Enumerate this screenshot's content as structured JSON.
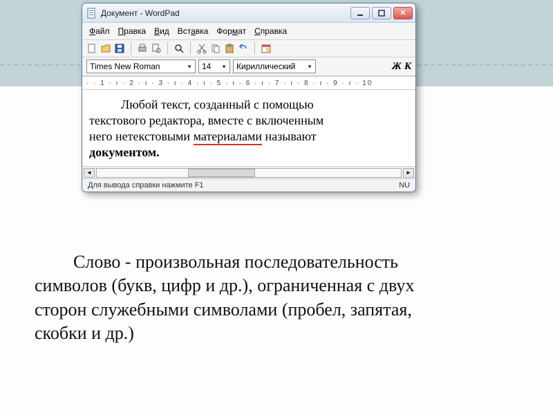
{
  "window": {
    "title": "Документ - WordPad",
    "menus": [
      "Файл",
      "Правка",
      "Вид",
      "Вставка",
      "Формат",
      "Справка"
    ],
    "font_name": "Times New Roman",
    "font_size": "14",
    "charset": "Кириллический",
    "bold_label": "Ж",
    "italic_label": "К",
    "ruler_text": "· · 1 · ı · 2 · ı · 3 · ı · 4 · ı · 5 · ı · 6 · ı · 7 · ı · 8 · ı · 9 · ı · 10",
    "doc": {
      "line1a": "Любой текст, созданный с помощью",
      "line2": "текстового редактора, вместе с включенным",
      "line3a": "него нетекстовыми ",
      "line3u": "материалами",
      "line3b": " называют",
      "line4": "документом."
    },
    "status_left": "Для вывода справки нажмите F1",
    "status_right": "NU"
  },
  "caption": {
    "t1": "Слово - произвольная последовательность",
    "t2": "символов (букв, цифр и др.), ограниченная с двух",
    "t3": "сторон служебными символами (пробел, запятая,",
    "t4": "скобки и др.)"
  }
}
